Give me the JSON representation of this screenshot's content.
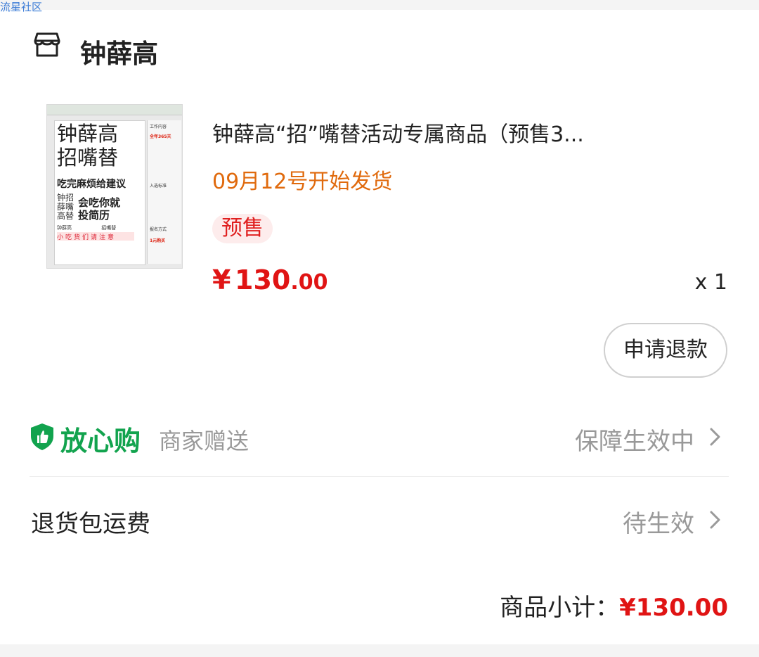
{
  "watermark": "流星社区",
  "shop": {
    "name": "钟薛高",
    "icon": "store-icon"
  },
  "product": {
    "title": "钟薛高“招”嘴替活动专属商品（预售3...",
    "ship_note": "09月12号开始发货",
    "badge": "预售",
    "price_symbol": "¥",
    "price_int": "130",
    "price_dec": ".00",
    "quantity": "x 1",
    "thumbnail": {
      "headline_1": "钟薛高",
      "headline_2": "招嘴替",
      "tagline": "吃完麻烦给建议",
      "side_vertical": "钟招薛嘴高替",
      "call": "会吃你就投简历",
      "footer_left": "钟薛高",
      "footer_right": "招嘴替",
      "banner": "小吃货们请注意",
      "side_1": "工作内容",
      "side_2": "全年365天",
      "side_3": "入选标准",
      "side_4": "报名方式",
      "side_5": "1元购买"
    }
  },
  "actions": {
    "refund_label": "申请退款"
  },
  "assurance": {
    "title": "放心购",
    "subtitle": "商家赠送",
    "status": "保障生效中",
    "icon": "shield-thumb-icon",
    "color": "#12a34e"
  },
  "return_shipping": {
    "label": "退货包运费",
    "status": "待生效"
  },
  "summary": {
    "label": "商品小计：",
    "amount": "¥130.00"
  },
  "colors": {
    "price": "#e01414",
    "ship": "#e06a0d"
  }
}
